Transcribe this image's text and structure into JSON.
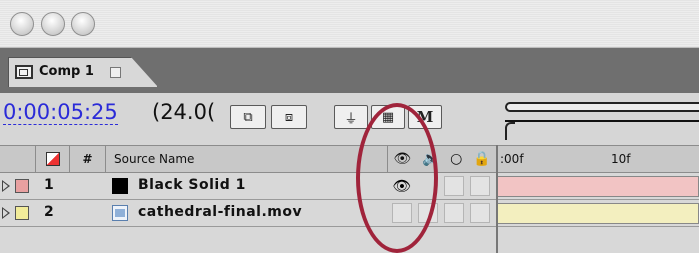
{
  "window": {
    "traffic_lights": [
      "close",
      "minimize",
      "zoom"
    ]
  },
  "tab": {
    "label": "Comp 1",
    "icon": "composition-icon"
  },
  "toolbar": {
    "timecode": "0:00:05:25",
    "fps_text": "(24.0(",
    "buttons": [
      {
        "name": "snapshot-button",
        "icon": "camera-icon",
        "glyph": "⧉"
      },
      {
        "name": "show-snapshot-button",
        "icon": "snapshot-view-icon",
        "glyph": "⧈"
      },
      {
        "name": "draft-3d-button",
        "icon": "draft-3d-icon",
        "glyph": "⏚"
      },
      {
        "name": "frame-blending-button",
        "icon": "film-icon",
        "glyph": "▦"
      },
      {
        "name": "motion-blur-button",
        "label": "M"
      }
    ]
  },
  "header": {
    "label_col": "#",
    "source_name": "Source Name",
    "switches": [
      "eye-icon",
      "speaker-icon",
      "solo-icon",
      "lock-icon"
    ],
    "time_ticks": [
      ":00f",
      "10f"
    ]
  },
  "layers": [
    {
      "num": "1",
      "name": "Black Solid 1",
      "label_color": "#e8a0a0",
      "source_icon": "solid-icon",
      "source_color": "#000000",
      "video_on": true,
      "bar_color": "#f2c4c4"
    },
    {
      "num": "2",
      "name": "cathedral-final.mov",
      "label_color": "#f2ec9a",
      "source_icon": "movie-file-icon",
      "source_color": "#8fb0d8",
      "video_on": false,
      "bar_color": "#f3efbf"
    }
  ],
  "annotation": {
    "color": "#a0243b",
    "target": "video-switch-column"
  }
}
